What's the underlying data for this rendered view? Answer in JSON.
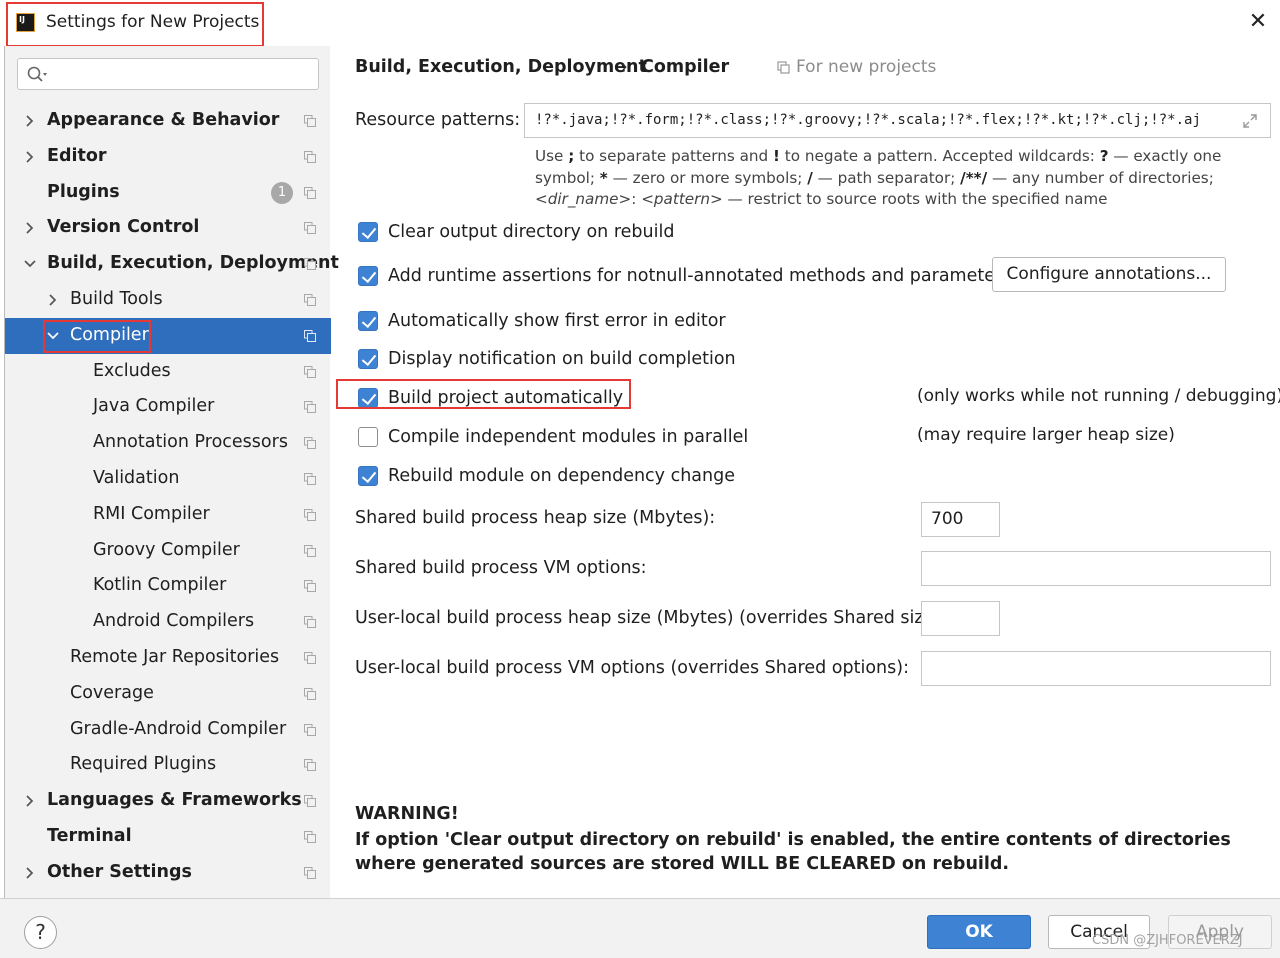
{
  "window": {
    "title": "Settings for New Projects",
    "close_glyph": "✕"
  },
  "sidebar": {
    "search_placeholder": "",
    "items": [
      {
        "label": "Appearance & Behavior",
        "bold": true,
        "expandable": true,
        "expanded": false
      },
      {
        "label": "Editor",
        "bold": true,
        "expandable": true,
        "expanded": false
      },
      {
        "label": "Plugins",
        "bold": true,
        "expandable": false,
        "badge": "1"
      },
      {
        "label": "Version Control",
        "bold": true,
        "expandable": true,
        "expanded": false
      },
      {
        "label": "Build, Execution, Deployment",
        "bold": true,
        "expandable": true,
        "expanded": true
      },
      {
        "label": "Build Tools",
        "bold": false,
        "expandable": true,
        "expanded": false
      },
      {
        "label": "Compiler",
        "bold": false,
        "expandable": true,
        "expanded": true,
        "selected": true
      },
      {
        "label": "Excludes",
        "bold": false
      },
      {
        "label": "Java Compiler",
        "bold": false
      },
      {
        "label": "Annotation Processors",
        "bold": false
      },
      {
        "label": "Validation",
        "bold": false
      },
      {
        "label": "RMI Compiler",
        "bold": false
      },
      {
        "label": "Groovy Compiler",
        "bold": false
      },
      {
        "label": "Kotlin Compiler",
        "bold": false
      },
      {
        "label": "Android Compilers",
        "bold": false
      },
      {
        "label": "Remote Jar Repositories",
        "bold": false
      },
      {
        "label": "Coverage",
        "bold": false
      },
      {
        "label": "Gradle-Android Compiler",
        "bold": false
      },
      {
        "label": "Required Plugins",
        "bold": false
      },
      {
        "label": "Languages & Frameworks",
        "bold": true,
        "expandable": true,
        "expanded": false
      },
      {
        "label": "Terminal",
        "bold": true
      },
      {
        "label": "Other Settings",
        "bold": true,
        "expandable": true,
        "expanded": false
      }
    ]
  },
  "main": {
    "breadcrumb": "Build, Execution, Deployment",
    "breadcrumb_sep": "›",
    "breadcrumb_current": "Compiler",
    "scope_note": "For new projects",
    "resource_patterns_label": "Resource patterns:",
    "resource_patterns_value": "!?*.java;!?*.form;!?*.class;!?*.groovy;!?*.scala;!?*.flex;!?*.kt;!?*.clj;!?*.aj",
    "hint": {
      "p1": "Use ",
      "b1": ";",
      "p2": " to separate patterns and ",
      "b2": "!",
      "p3": " to negate a pattern. Accepted wildcards: ",
      "b3": "?",
      "p4": " — exactly one symbol; ",
      "b4": "*",
      "p5": " — zero or more symbols; ",
      "b5": "/",
      "p6": " — path separator; ",
      "b6": "/**/",
      "p7": " — any number of directories; ",
      "i1": "<dir_name>",
      "p8": ": ",
      "i2": "<pattern>",
      "p9": " — restrict to source roots with the specified name"
    },
    "checkboxes": [
      {
        "label": "Clear output directory on rebuild",
        "checked": true
      },
      {
        "label": "Add runtime assertions for notnull-annotated methods and parameters",
        "checked": true
      },
      {
        "label": "Automatically show first error in editor",
        "checked": true
      },
      {
        "label": "Display notification on build completion",
        "checked": true
      },
      {
        "label": "Build project automatically",
        "checked": true
      },
      {
        "label": "Compile independent modules in parallel",
        "checked": false
      },
      {
        "label": "Rebuild module on dependency change",
        "checked": true
      }
    ],
    "configure_button": "Configure annotations...",
    "note_build_auto": "(only works while not running / debugging)",
    "note_parallel": "(may require larger heap size)",
    "fields": [
      {
        "label": "Shared build process heap size (Mbytes):",
        "value": "700"
      },
      {
        "label": "Shared build process VM options:",
        "value": ""
      },
      {
        "label": "User-local build process heap size (Mbytes) (overrides Shared size):",
        "value": ""
      },
      {
        "label": "User-local build process VM options (overrides Shared options):",
        "value": ""
      }
    ],
    "warning_title": "WARNING!",
    "warning_text": "If option 'Clear output directory on rebuild' is enabled, the entire contents of directories where generated sources are stored WILL BE CLEARED on rebuild."
  },
  "footer": {
    "help": "?",
    "ok": "OK",
    "cancel": "Cancel",
    "apply": "Apply",
    "watermark": "CSDN @ZJHFOREVERZJ"
  },
  "colors": {
    "accent": "#3e82d4",
    "selected_row": "#2f6ebd",
    "highlight_box": "#e53935"
  }
}
